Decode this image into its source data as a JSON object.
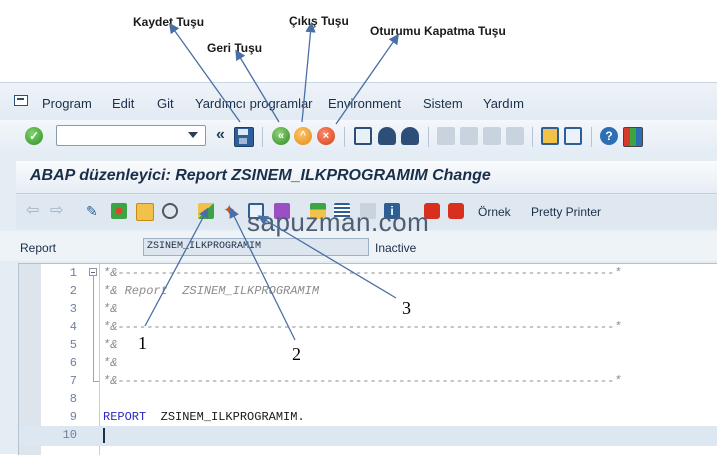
{
  "annotations": {
    "save": "Kaydet Tuşu",
    "back": "Geri Tuşu",
    "exit": "Çıkış Tuşu",
    "logoff": "Oturumu Kapatma Tuşu",
    "n1": "1",
    "n2": "2",
    "n3": "3"
  },
  "menu": {
    "items": [
      "Program",
      "Edit",
      "Git",
      "Yardımcı programlar",
      "Environment",
      "Sistem",
      "Yardım"
    ]
  },
  "toolbar": {
    "command_value": "",
    "nav_symbol": "«"
  },
  "title": "ABAP düzenleyici: Report ZSINEM_ILKPROGRAMIM Change",
  "app_toolbar": {
    "example_label": "Örnek",
    "pretty_printer_label": "Pretty Printer"
  },
  "watermark": "sapuzman.com",
  "report": {
    "label": "Report",
    "name": "ZSINEM_ILKPROGRAMIM",
    "status": "Inactive"
  },
  "editor": {
    "lines": [
      {
        "no": "1",
        "text": "*&---------------------------------------------------------------------*"
      },
      {
        "no": "2",
        "text": "*& Report  ZSINEM_ILKPROGRAMIM"
      },
      {
        "no": "3",
        "text": "*&"
      },
      {
        "no": "4",
        "text": "*&---------------------------------------------------------------------*"
      },
      {
        "no": "5",
        "text": "*&"
      },
      {
        "no": "6",
        "text": "*&"
      },
      {
        "no": "7",
        "text": "*&---------------------------------------------------------------------*"
      },
      {
        "no": "8",
        "text": ""
      },
      {
        "no": "9",
        "keyword": "REPORT",
        "text": "  ZSINEM_ILKPROGRAMIM."
      },
      {
        "no": "10",
        "text": ""
      }
    ]
  },
  "colors": {
    "accent": "#1a2f4a",
    "keyword": "#2a2ac4",
    "comment": "#8b8b8b",
    "current_line": "#dde7f2"
  },
  "icons": [
    "menu-icon",
    "ok-icon",
    "save-icon",
    "back-icon",
    "exit-icon",
    "logoff-icon",
    "print-icon",
    "find-icon",
    "help-icon"
  ]
}
